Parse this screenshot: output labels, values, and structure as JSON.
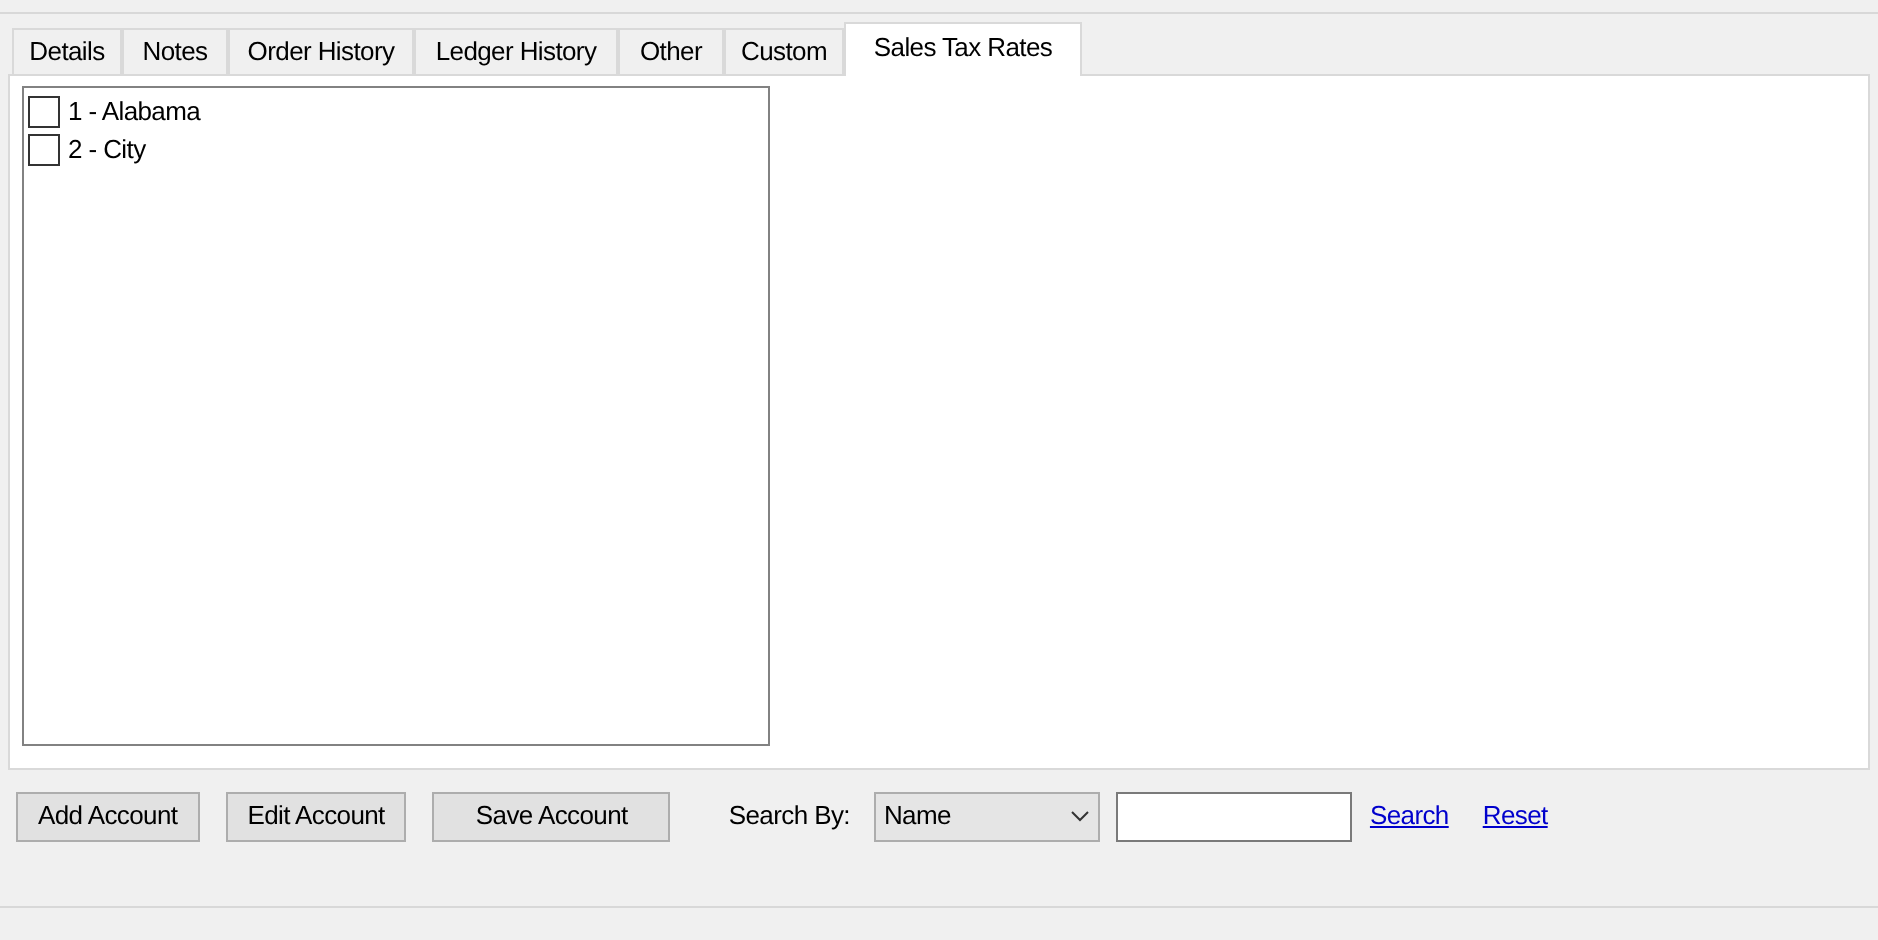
{
  "tabs": [
    {
      "label": "Details",
      "selected": false
    },
    {
      "label": "Notes",
      "selected": false
    },
    {
      "label": "Order History",
      "selected": false
    },
    {
      "label": "Ledger History",
      "selected": false
    },
    {
      "label": "Other",
      "selected": false
    },
    {
      "label": "Custom",
      "selected": false
    },
    {
      "label": "Sales Tax Rates",
      "selected": true
    }
  ],
  "tax_rates": [
    {
      "label": "1 - Alabama",
      "checked": false
    },
    {
      "label": "2 - City",
      "checked": false
    }
  ],
  "buttons": [
    "Add Account",
    "Edit Account",
    "Save Account"
  ],
  "search": {
    "label": "Search By:",
    "field": "Name",
    "search_link": "Search",
    "reset_link": "Reset"
  }
}
